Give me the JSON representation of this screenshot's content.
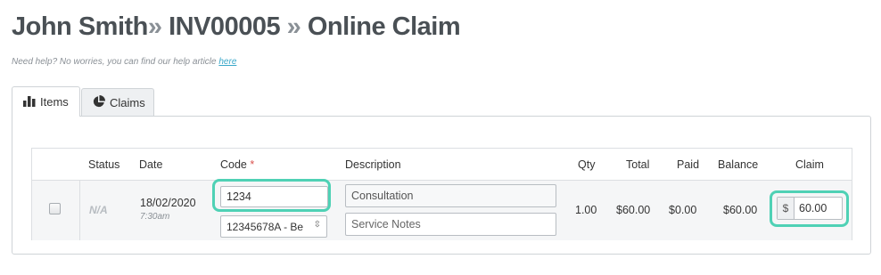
{
  "header": {
    "crumb_patient": "John Smith",
    "sep": "»",
    "crumb_invoice": "INV00005",
    "crumb_page": "Online Claim"
  },
  "help": {
    "text": "Need help? No worries, you can find our help article ",
    "link_text": "here"
  },
  "tabs": [
    {
      "label": "Items",
      "icon": "bar-chart-icon",
      "active": true
    },
    {
      "label": "Claims",
      "icon": "pie-chart-icon",
      "active": false
    }
  ],
  "table": {
    "headers": {
      "status": "Status",
      "date": "Date",
      "code": "Code",
      "required_mark": "*",
      "description": "Description",
      "qty": "Qty",
      "total": "Total",
      "paid": "Paid",
      "balance": "Balance",
      "claim": "Claim"
    },
    "rows": [
      {
        "checked": false,
        "status": "N/A",
        "date": "18/02/2020",
        "time": "7:30am",
        "code_value": "1234",
        "code_select": "12345678A - Be",
        "description_value": "Consultation",
        "notes_placeholder": "Service Notes",
        "qty": "1.00",
        "total": "$60.00",
        "paid": "$0.00",
        "balance": "$60.00",
        "claim_currency": "$",
        "claim_value": "60.00"
      }
    ]
  },
  "colors": {
    "highlight": "#4fd1b5",
    "title": "#4a5055",
    "link": "#3aa8c9",
    "required": "#d9534f"
  }
}
